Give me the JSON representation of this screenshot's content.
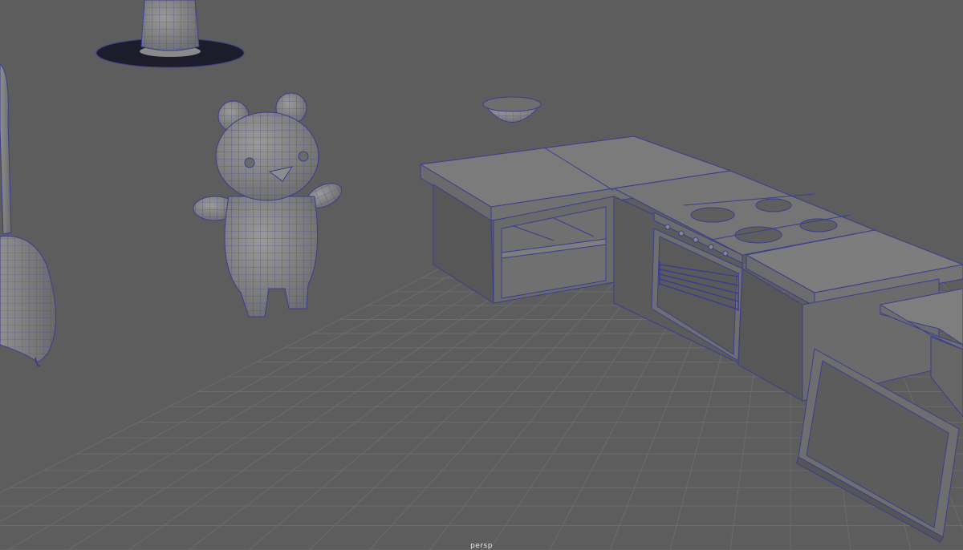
{
  "viewport": {
    "camera_label": "persp",
    "colors": {
      "background": "#5d5d5d",
      "grid_line": "#6c6c6c",
      "wireframe": "#3a3d8f",
      "surface_light": "#8a8a8a",
      "surface_mid": "#7b7b7b",
      "surface_dark": "#5f5f5f"
    },
    "objects": [
      "witch-hat",
      "broom",
      "teddy-bear",
      "bowl",
      "kitchen-counter",
      "stove",
      "oven",
      "cabinet-door"
    ]
  }
}
